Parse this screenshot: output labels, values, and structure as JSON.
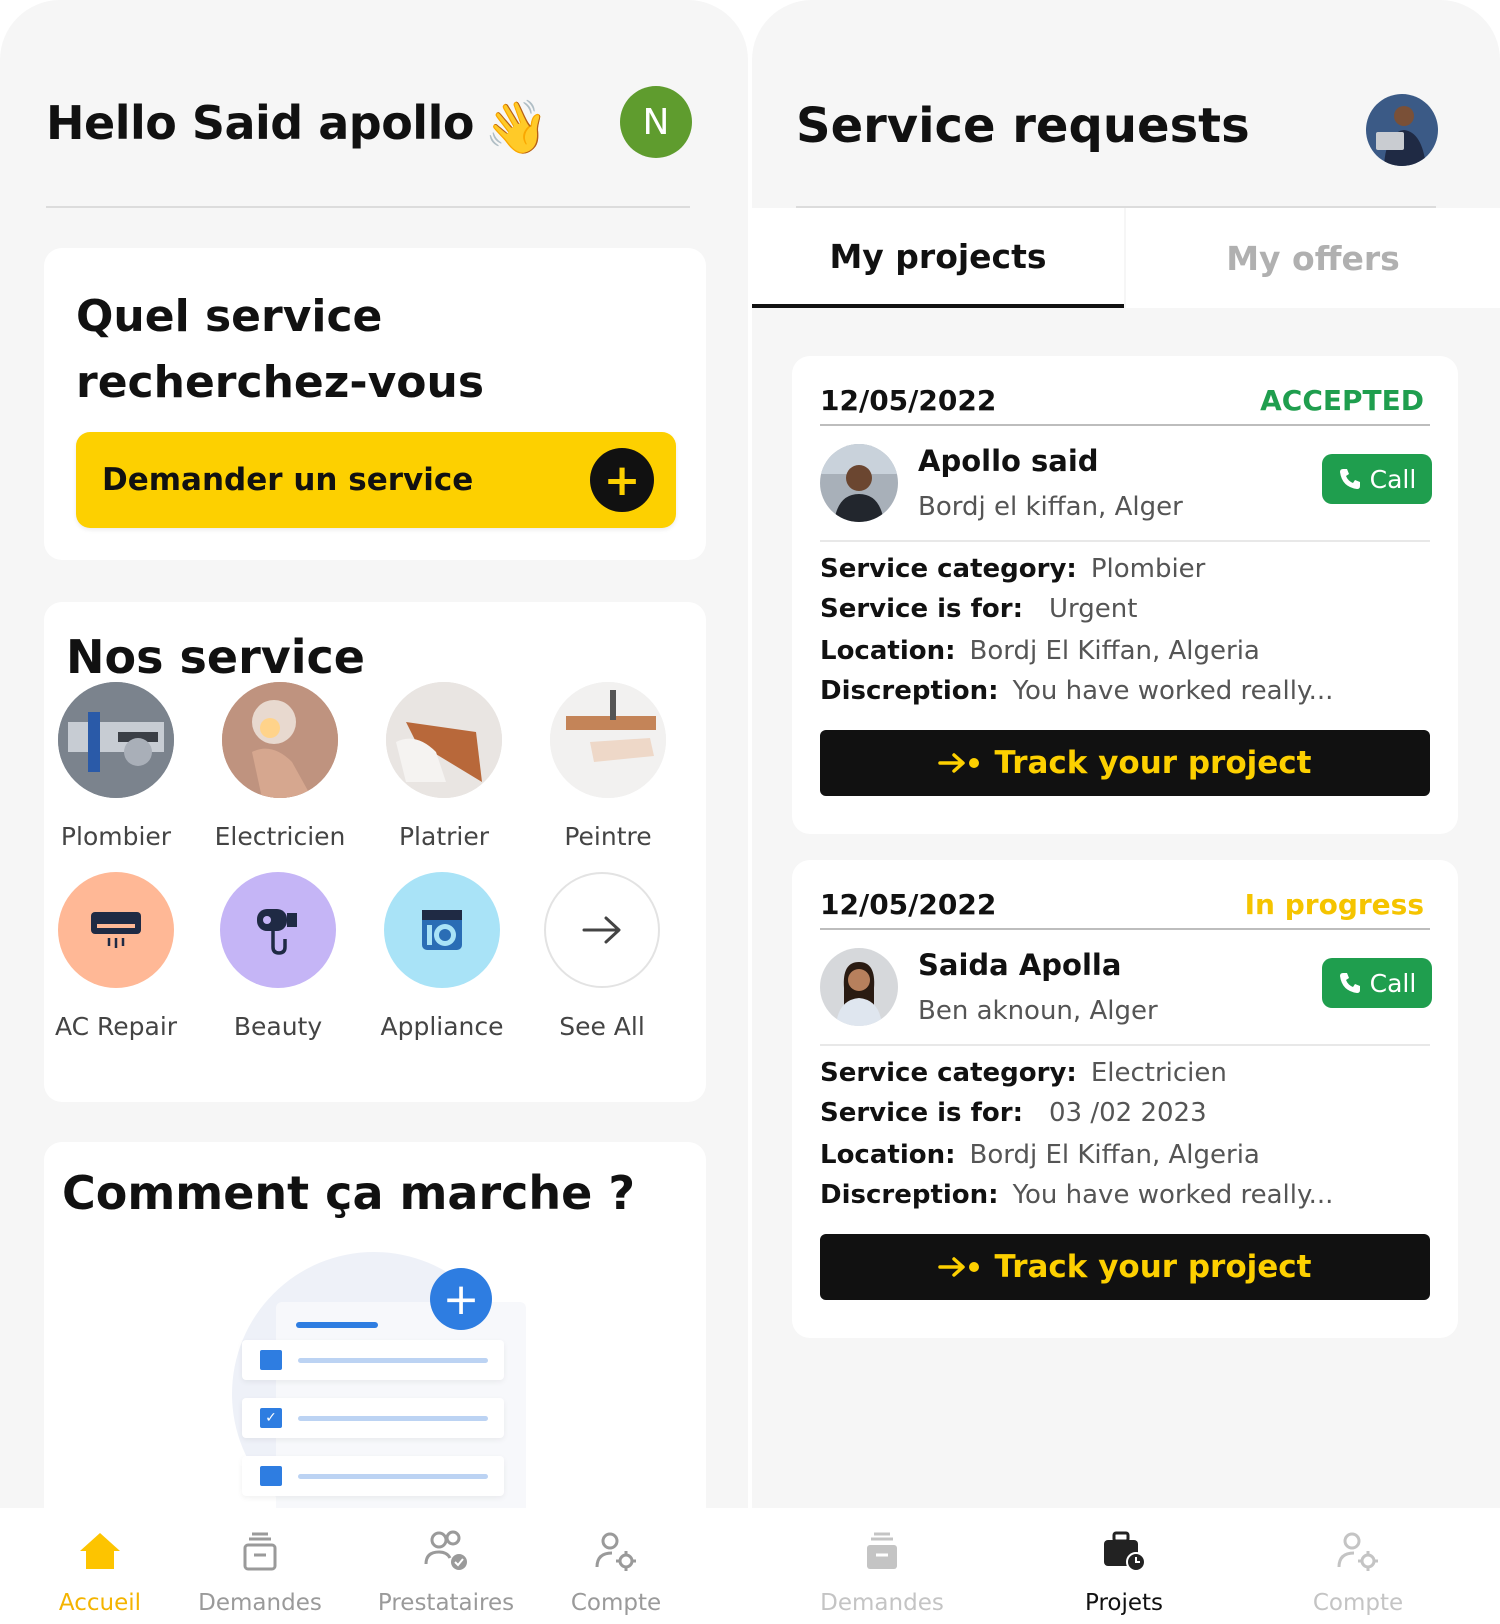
{
  "left": {
    "greeting": "Hello Said apollo",
    "wave_emoji": "👋",
    "avatar_letter": "N",
    "search_card": {
      "title": "Quel service recherchez-vous",
      "cta_label": "Demander un service",
      "cta_icon": "plus-icon"
    },
    "services": {
      "title": "Nos service",
      "items": [
        {
          "label": "Plombier",
          "icon": "plumber-photo"
        },
        {
          "label": "Electricien",
          "icon": "electrician-photo"
        },
        {
          "label": "Platrier",
          "icon": "plasterer-photo"
        },
        {
          "label": "Peintre",
          "icon": "painter-photo"
        },
        {
          "label": "AC Repair",
          "icon": "air-conditioner-icon",
          "color": "#ffb896"
        },
        {
          "label": "Beauty",
          "icon": "hair-dryer-icon",
          "color": "#c5b5f6"
        },
        {
          "label": "Appliance",
          "icon": "washing-machine-icon",
          "color": "#a9e3f7"
        },
        {
          "label": "See All",
          "icon": "arrow-right-icon"
        }
      ]
    },
    "how": {
      "title": "Comment ça marche ?"
    },
    "nav": [
      {
        "label": "Accueil",
        "icon": "home-icon",
        "active": true
      },
      {
        "label": "Demandes",
        "icon": "inbox-icon"
      },
      {
        "label": "Prestataires",
        "icon": "providers-icon"
      },
      {
        "label": "Compte",
        "icon": "account-settings-icon"
      }
    ]
  },
  "right": {
    "title": "Service requests",
    "tabs": [
      {
        "label": "My projects",
        "active": true
      },
      {
        "label": "My offers"
      }
    ],
    "projects": [
      {
        "date": "12/05/2022",
        "status": "ACCEPTED",
        "status_color": "#1f9e4e",
        "name": "Apollo said",
        "place": "Bordj el kiffan, Alger",
        "call_label": "Call",
        "fields": [
          {
            "label": "Service category:",
            "value": "Plombier"
          },
          {
            "label": "Service is for:",
            "value": "Urgent"
          },
          {
            "label": "Location:",
            "value": "Bordj El Kiffan, Algeria"
          },
          {
            "label": "Discreption:",
            "value": "You have worked really..."
          }
        ],
        "track_label": "Track your project"
      },
      {
        "date": "12/05/2022",
        "status": "In progress",
        "status_color": "#f5c400",
        "name": "Saida Apolla",
        "place": "Ben aknoun, Alger",
        "call_label": "Call",
        "fields": [
          {
            "label": "Service category:",
            "value": "Electricien"
          },
          {
            "label": "Service is for:",
            "value": "03 /02 2023"
          },
          {
            "label": "Location:",
            "value": "Bordj El Kiffan, Algeria"
          },
          {
            "label": "Discreption:",
            "value": "You have worked really..."
          }
        ],
        "track_label": "Track your project"
      }
    ],
    "nav": [
      {
        "label": "Demandes",
        "icon": "inbox-icon"
      },
      {
        "label": "Projets",
        "icon": "briefcase-clock-icon",
        "active": true
      },
      {
        "label": "Compte",
        "icon": "account-settings-icon"
      }
    ]
  },
  "colors": {
    "accent_yellow": "#fdd000",
    "call_green": "#1f9e4e",
    "illustration_blue": "#2e7de1"
  }
}
